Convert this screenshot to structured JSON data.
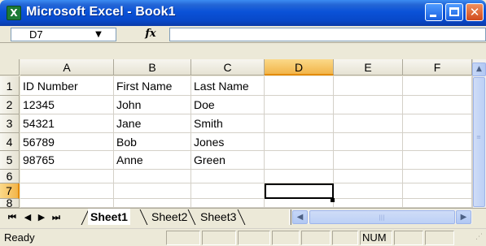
{
  "window": {
    "title": "Microsoft Excel - Book1",
    "app_icon": "excel-icon",
    "controls": {
      "minimize": "minimize-icon",
      "maximize": "maximize-icon",
      "close": "close-icon",
      "close_glyph": "✕"
    }
  },
  "formula_bar": {
    "name_box": "D7",
    "fx_label": "fx",
    "formula_value": ""
  },
  "sheet": {
    "columns": [
      "A",
      "B",
      "C",
      "D",
      "E",
      "F"
    ],
    "active_column": "D",
    "rows": [
      "1",
      "2",
      "3",
      "4",
      "5",
      "6",
      "7",
      "8"
    ],
    "active_row": "7",
    "cells": [
      [
        "ID Number",
        "First Name",
        "Last Name",
        "",
        "",
        ""
      ],
      [
        "12345",
        "John",
        "Doe",
        "",
        "",
        ""
      ],
      [
        "54321",
        "Jane",
        "Smith",
        "",
        "",
        ""
      ],
      [
        "56789",
        "Bob",
        "Jones",
        "",
        "",
        ""
      ],
      [
        "98765",
        "Anne",
        "Green",
        "",
        "",
        ""
      ],
      [
        "",
        "",
        "",
        "",
        "",
        ""
      ],
      [
        "",
        "",
        "",
        "",
        "",
        ""
      ],
      [
        "",
        "",
        "",
        "",
        "",
        ""
      ]
    ],
    "selected_cell": "D7"
  },
  "tabs": {
    "items": [
      "Sheet1",
      "Sheet2",
      "Sheet3"
    ],
    "active": "Sheet1",
    "nav_icons": [
      "first-sheet-icon",
      "prev-sheet-icon",
      "next-sheet-icon",
      "last-sheet-icon"
    ]
  },
  "status_bar": {
    "status": "Ready",
    "num_indicator": "NUM"
  },
  "colors": {
    "title_bar": "#0a52d8",
    "active_header": "#f2b54a",
    "active_header_border": "#e38b0b",
    "grid_line": "#d4d0c8"
  }
}
